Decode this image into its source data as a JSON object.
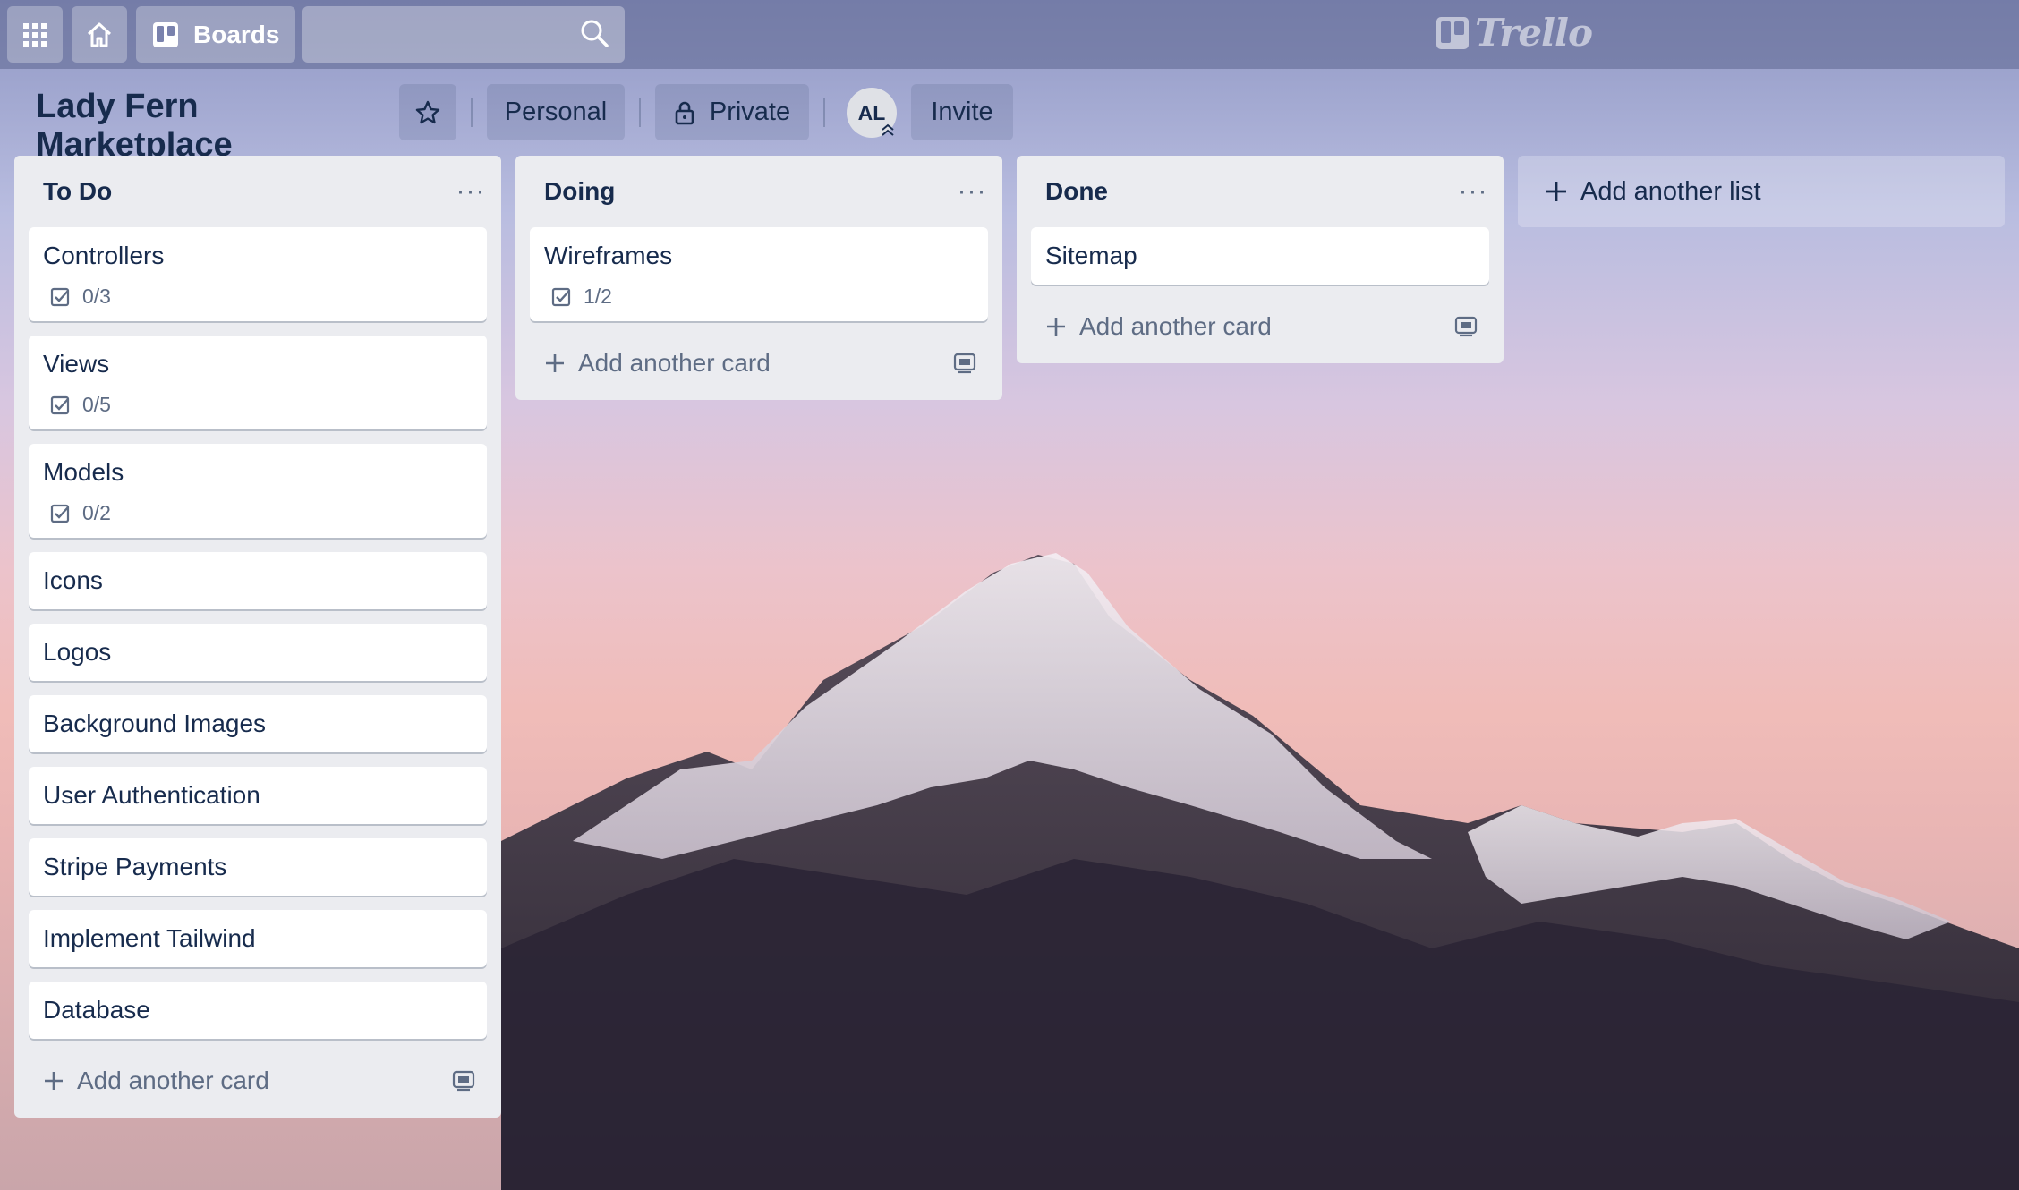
{
  "header": {
    "boards_label": "Boards",
    "search_placeholder": "",
    "logo_text": "Trello"
  },
  "board": {
    "title": "Lady Fern Marketplace",
    "team_label": "Personal",
    "visibility_label": "Private",
    "member_initials": "AL",
    "invite_label": "Invite"
  },
  "lists": [
    {
      "title": "To Do",
      "cards": [
        {
          "title": "Controllers",
          "checklist": "0/3"
        },
        {
          "title": "Views",
          "checklist": "0/5"
        },
        {
          "title": "Models",
          "checklist": "0/2"
        },
        {
          "title": "Icons"
        },
        {
          "title": "Logos"
        },
        {
          "title": "Background Images"
        },
        {
          "title": "User Authentication"
        },
        {
          "title": "Stripe Payments"
        },
        {
          "title": "Implement Tailwind"
        },
        {
          "title": "Database"
        }
      ],
      "add_card_label": "Add another card"
    },
    {
      "title": "Doing",
      "cards": [
        {
          "title": "Wireframes",
          "checklist": "1/2"
        }
      ],
      "add_card_label": "Add another card"
    },
    {
      "title": "Done",
      "cards": [
        {
          "title": "Sitemap"
        }
      ],
      "add_card_label": "Add another card"
    }
  ],
  "add_list_label": "Add another list",
  "colors": {
    "header_bar": "#646c96",
    "list_bg": "#ebecf0",
    "text_primary": "#172b4d",
    "text_secondary": "#5e6c84"
  }
}
